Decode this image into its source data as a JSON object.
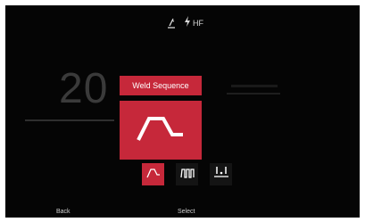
{
  "status_bar": {
    "hf_label": "HF",
    "icons": [
      "torch-remote-icon",
      "lightning-icon"
    ]
  },
  "background": {
    "value_text": "20"
  },
  "popup": {
    "title": "Weld Sequence",
    "current_icon": "2t-sequence-icon"
  },
  "options": [
    {
      "icon": "2t-sequence-icon",
      "selected": true
    },
    {
      "icon": "pulse-sequence-icon",
      "selected": false
    },
    {
      "icon": "spot-weld-icon",
      "selected": false
    }
  ],
  "bottom_bar": {
    "back_label": "Back",
    "select_label": "Select"
  },
  "colors": {
    "accent": "#c6283a",
    "background": "#050505",
    "text": "#ffffff"
  }
}
